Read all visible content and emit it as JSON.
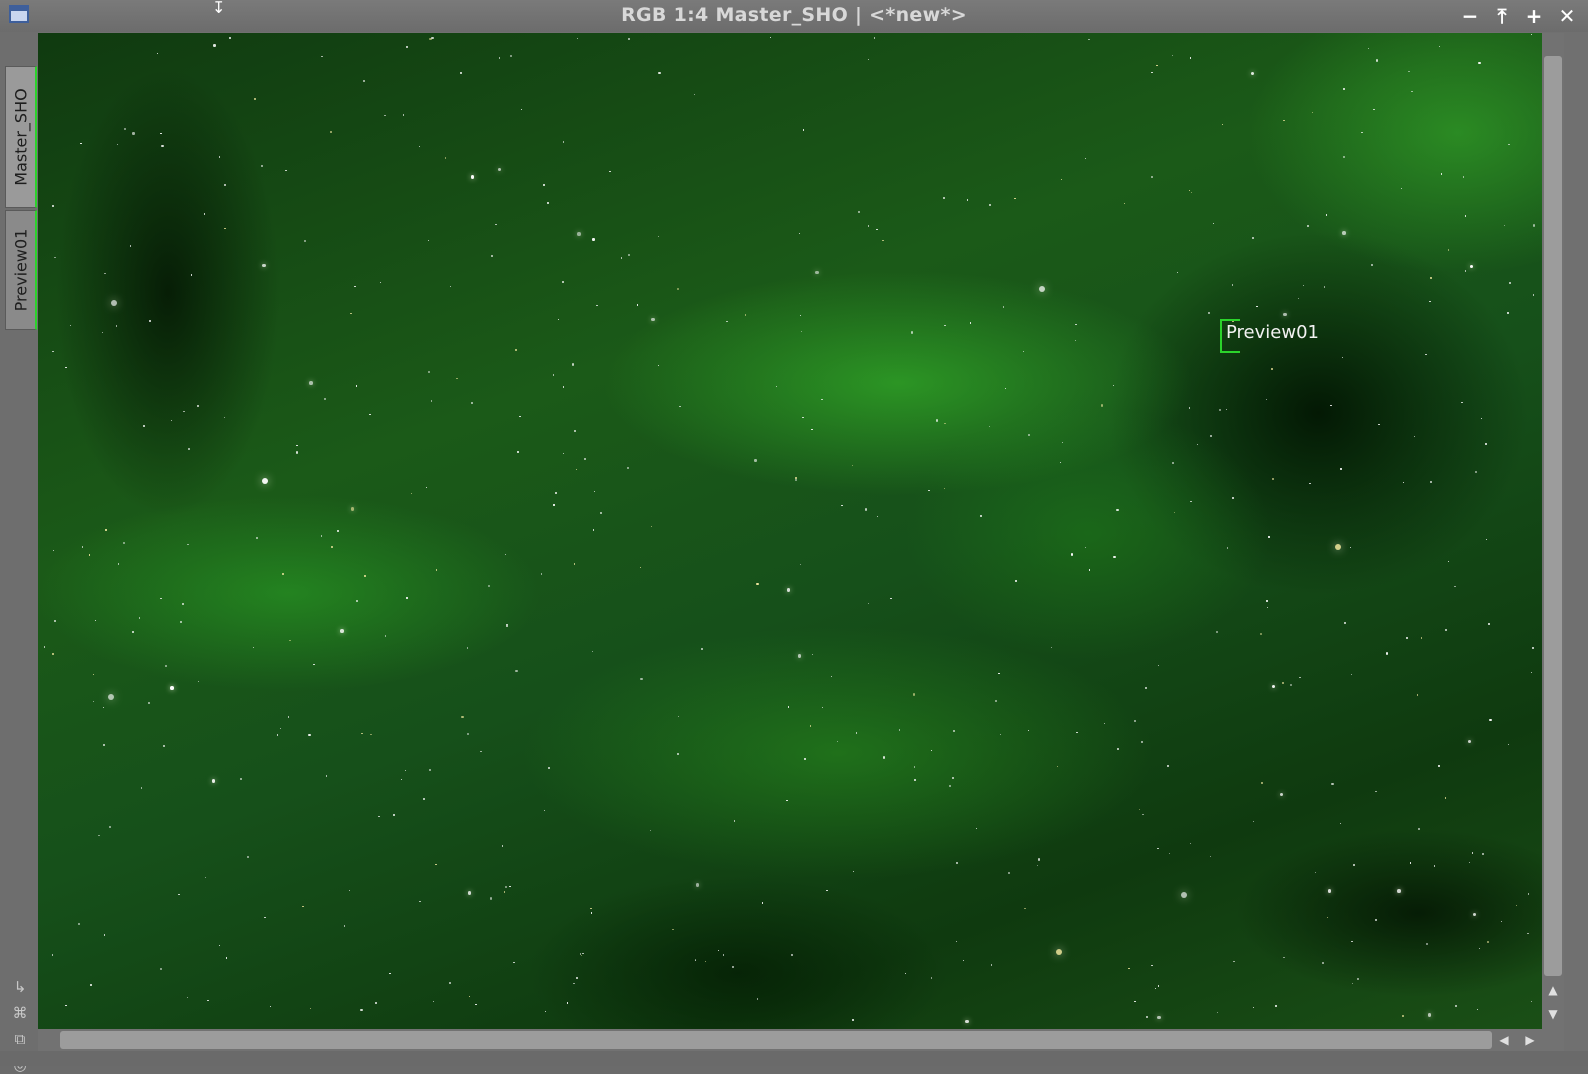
{
  "window": {
    "title": "RGB 1:4 Master_SHO | <*new*>",
    "app_icon": "image-window-icon",
    "controls": {
      "minimize": "−",
      "shade": "⤒",
      "maximize": "+",
      "close": "✕"
    }
  },
  "tabs": [
    {
      "label": "Master_SHO",
      "active": true
    },
    {
      "label": "Preview01",
      "active": false
    }
  ],
  "side_tools": [
    {
      "icon": "arrow-down-right-icon",
      "glyph": "↳"
    },
    {
      "icon": "fit-view-icon",
      "glyph": "⌘"
    },
    {
      "icon": "clone-icon",
      "glyph": "⧉"
    },
    {
      "icon": "target-icon",
      "glyph": "◎"
    }
  ],
  "image": {
    "description_color_accent": "#2bd32b",
    "preview_label": "Preview01"
  },
  "scroll": {
    "up": "▲",
    "down": "▼",
    "left": "◀",
    "right": "▶"
  }
}
